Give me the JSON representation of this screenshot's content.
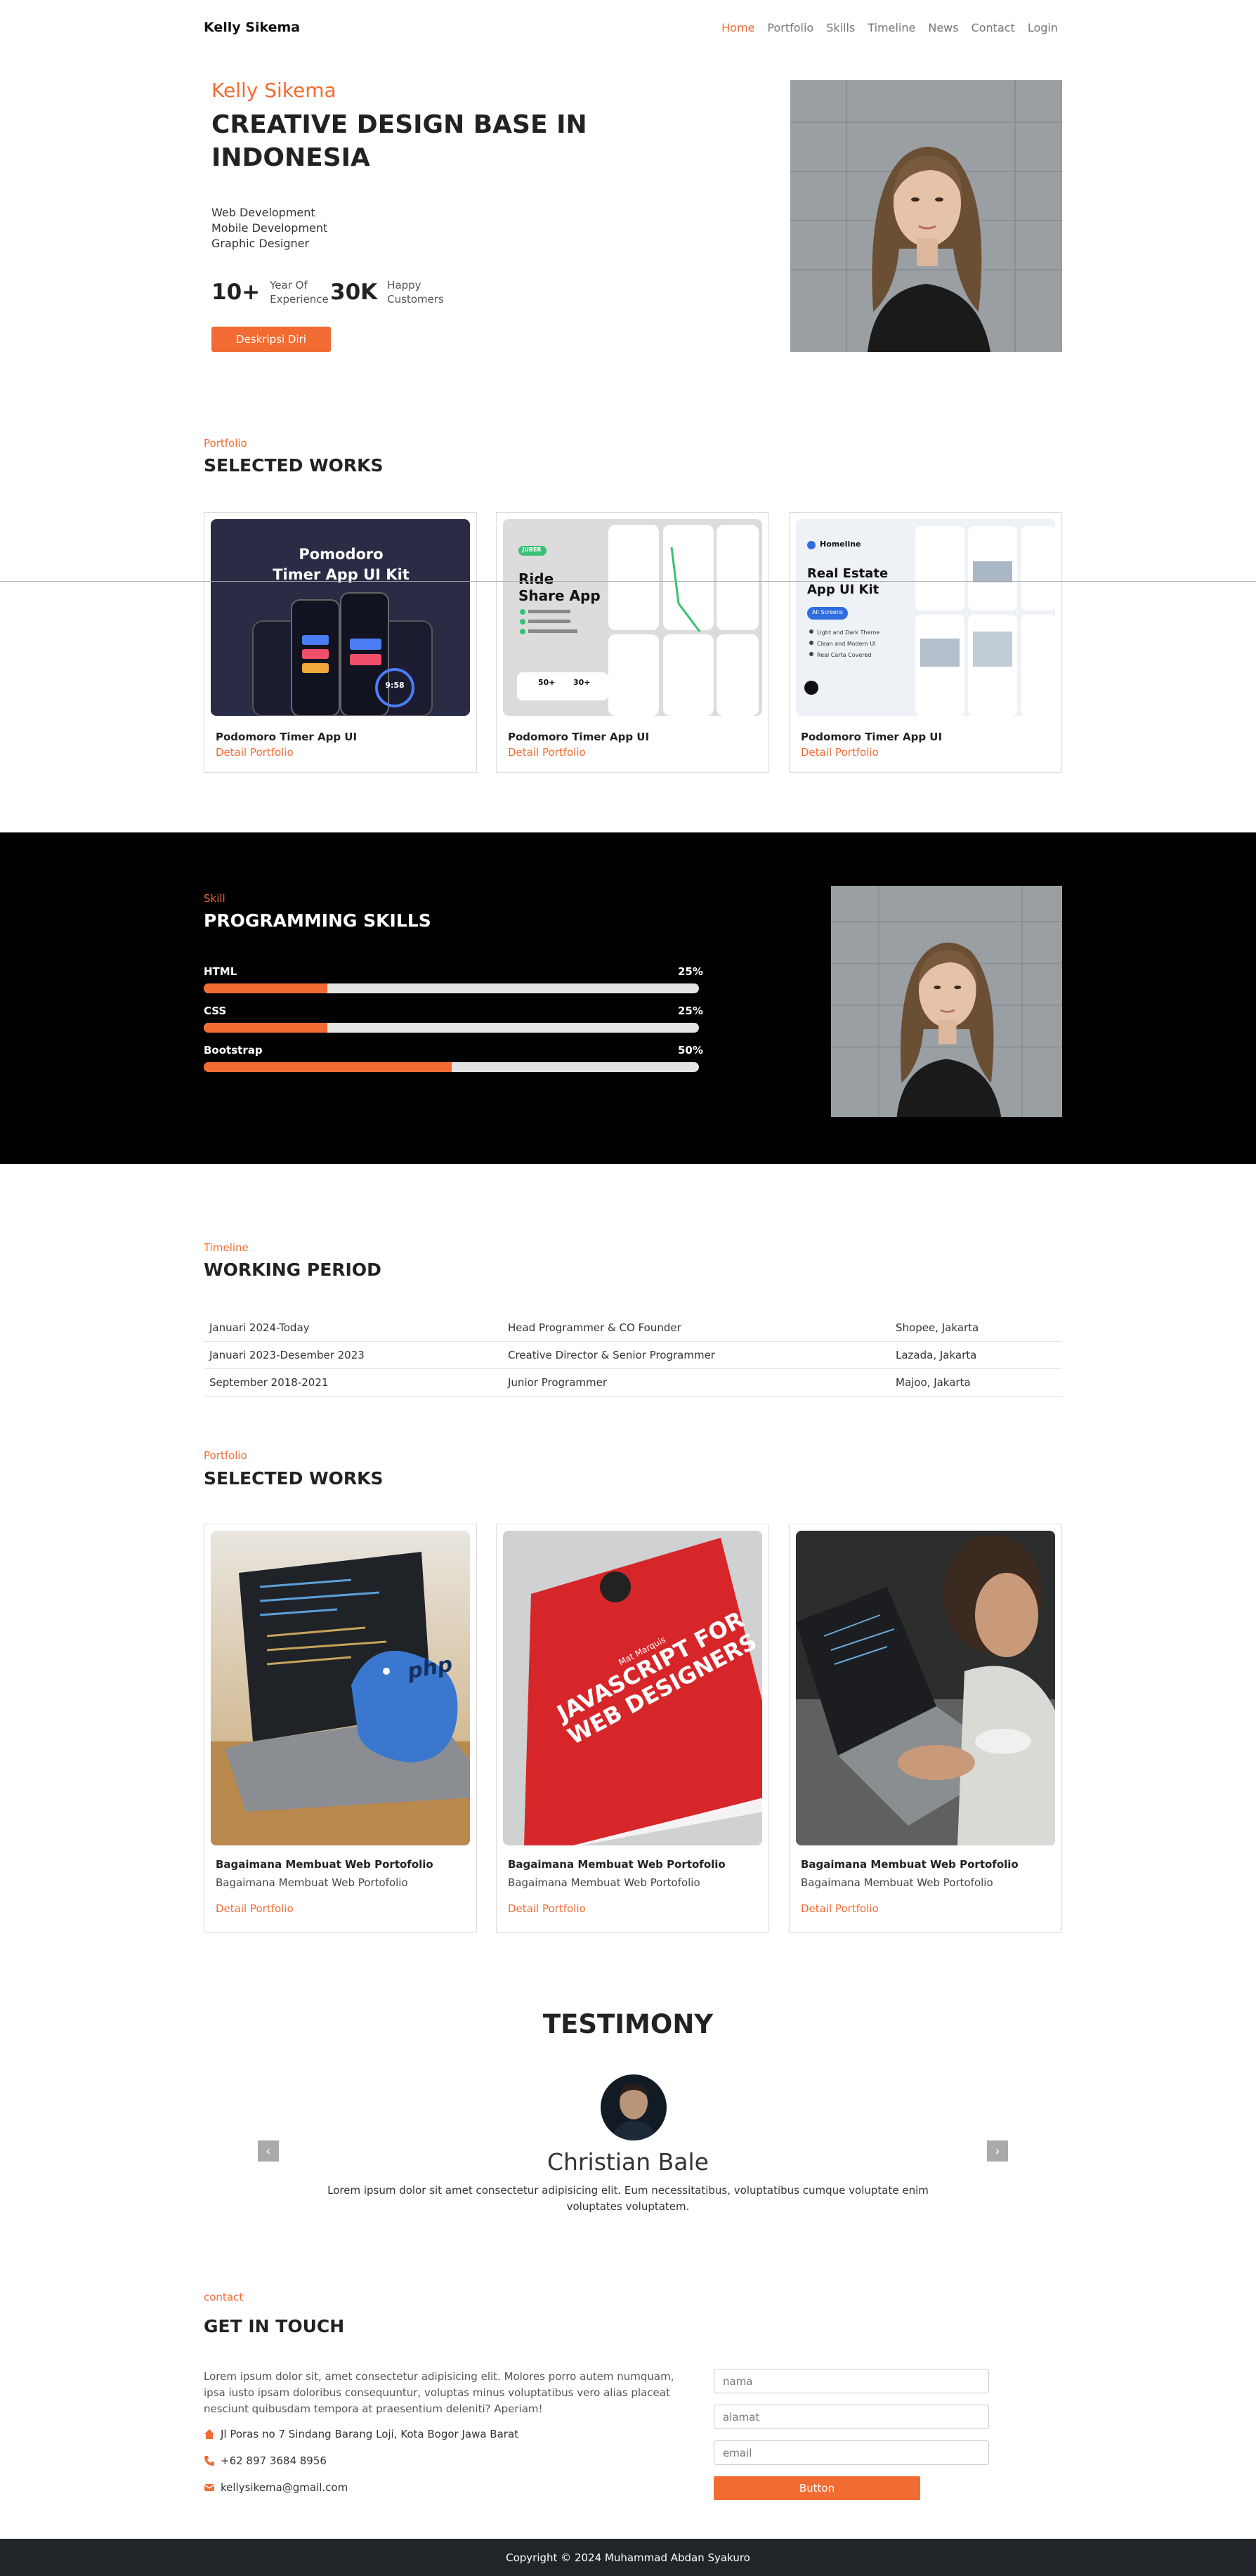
{
  "navbar": {
    "brand": "Kelly Sikema",
    "links": [
      "Home",
      "Portfolio",
      "Skills",
      "Timeline",
      "News",
      "Contact",
      "Login"
    ],
    "active": "Home"
  },
  "hero": {
    "name": "Kelly Sikema",
    "title": "CREATIVE DESIGN BASE IN INDONESIA",
    "roles": [
      "Web Development",
      "Mobile Development",
      "Graphic Designer"
    ],
    "stats": [
      {
        "value": "10+",
        "label_line1": "Year Of",
        "label_line2": "Experience"
      },
      {
        "value": "30K",
        "label_line1": "Happy",
        "label_line2": "Customers"
      }
    ],
    "button": "Deskripsi Diri"
  },
  "portfolio1": {
    "eyebrow": "Portfolio",
    "title": "SELECTED WORKS",
    "cards": [
      {
        "title": "Podomoro Timer App UI",
        "link": "Detail Portfolio",
        "image_text_1": "Pomodoro",
        "image_text_2": "Timer App UI  Kit",
        "image_time": "9:58"
      },
      {
        "title": "Podomoro Timer App UI",
        "link": "Detail Portfolio",
        "image_text_1": "Ride",
        "image_text_2": "Share App",
        "badge": "JUBER",
        "stat_1": "50+",
        "stat_2": "30+"
      },
      {
        "title": "Podomoro Timer App UI",
        "link": "Detail Portfolio",
        "image_brand": "Homeline",
        "image_text_1": "Real Estate",
        "image_text_2": "App UI Kit",
        "image_button": "All Screens",
        "bullets": [
          "Light and Dark Theme",
          "Clean and Modern UI",
          "Real Carta Covered"
        ]
      }
    ]
  },
  "skills": {
    "eyebrow": "Skill",
    "title": "PROGRAMMING SKILLS",
    "items": [
      {
        "label": "HTML",
        "percent_text": "25%",
        "percent": 25
      },
      {
        "label": "CSS",
        "percent_text": "25%",
        "percent": 25
      },
      {
        "label": "Bootstrap",
        "percent_text": "50%",
        "percent": 50
      }
    ]
  },
  "timeline": {
    "eyebrow": "Timeline",
    "title": "WORKING PERIOD",
    "rows": [
      {
        "period": "Januari 2024-Today",
        "role": "Head Programmer & CO Founder",
        "place": "Shopee, Jakarta"
      },
      {
        "period": "Januari 2023-Desember 2023",
        "role": "Creative Director & Senior Programmer",
        "place": "Lazada, Jakarta"
      },
      {
        "period": "September 2018-2021",
        "role": "Junior Programmer",
        "place": "Majoo, Jakarta"
      }
    ]
  },
  "portfolio2": {
    "eyebrow": "Portfolio",
    "title": "SELECTED WORKS",
    "cards": [
      {
        "title": "Bagaimana Membuat Web Portofolio",
        "subtitle": "Bagaimana Membuat Web Portofolio",
        "link": "Detail Portfolio",
        "image_text": "php"
      },
      {
        "title": "Bagaimana Membuat Web Portofolio",
        "subtitle": "Bagaimana Membuat Web Portofolio",
        "link": "Detail Portfolio",
        "image_text_1": "JAVASCRIPT FOR",
        "image_text_2": "WEB DESIGNERS",
        "image_text_3": "Mat Marquis"
      },
      {
        "title": "Bagaimana Membuat Web Portofolio",
        "subtitle": "Bagaimana Membuat Web Portofolio",
        "link": "Detail Portfolio"
      }
    ]
  },
  "testimony": {
    "title": "TESTIMONY",
    "name": "Christian Bale",
    "text": "Lorem ipsum dolor sit amet consectetur adipisicing elit. Eum necessitatibus, voluptatibus cumque voluptate enim voluptates voluptatem.",
    "prev_icon": "chevron-left-icon",
    "next_icon": "chevron-right-icon"
  },
  "contact": {
    "eyebrow": "contact",
    "title": "GET IN TOUCH",
    "text": "Lorem ipsum dolor sit, amet consectetur adipisicing elit. Molores porro autem numquam, ipsa iusto ipsam doloribus consequuntur, voluptas minus voluptatibus vero alias placeat nesciunt quibusdam tempora at praesentium deleniti? Aperiam!",
    "address": "Jl Poras no 7 Sindang Barang Loji, Kota Bogor Jawa Barat",
    "phone": "+62 897 3684 8956",
    "email": "kellysikema@gmail.com",
    "fields": {
      "name": "nama",
      "address": "alamat",
      "email": "email"
    },
    "button": "Button"
  },
  "footer": {
    "text": "Copyright © 2024 Muhammad Abdan Syakuro"
  },
  "colors": {
    "accent": "#f26b32",
    "dark": "#000000",
    "footer": "#212529"
  }
}
